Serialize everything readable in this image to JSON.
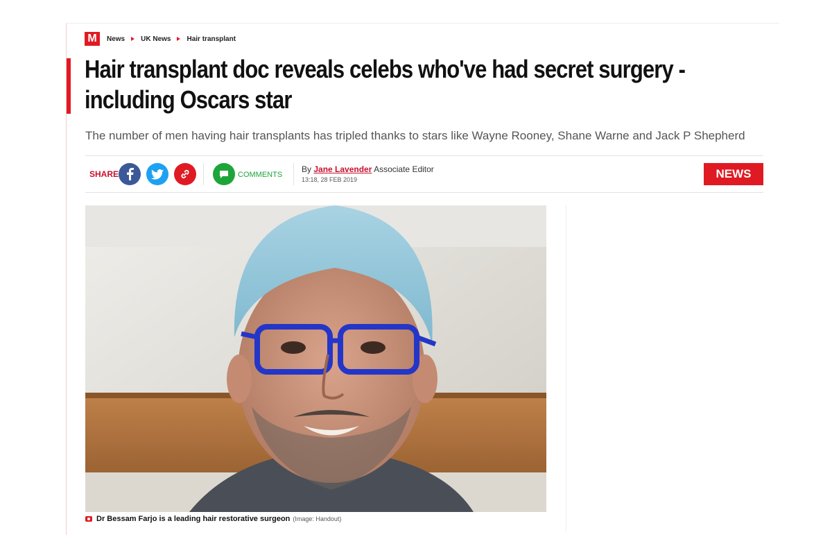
{
  "brand": {
    "logo_letter": "M",
    "accent_color": "#e01a22"
  },
  "breadcrumb": [
    "News",
    "UK News",
    "Hair transplant"
  ],
  "headline": "Hair transplant doc reveals celebs who've had secret surgery - including Oscars star",
  "subheadline": "The number of men having hair transplants has tripled thanks to stars like Wayne Rooney, Shane Warne and Jack P Shepherd",
  "share": {
    "label": "SHARE",
    "comments_label": "COMMENTS",
    "icons": [
      "facebook-icon",
      "twitter-icon",
      "link-icon",
      "comment-icon"
    ]
  },
  "byline": {
    "prefix": "By",
    "author": "Jane Lavender",
    "role": "Associate Editor",
    "timestamp": "13:18, 28 FEB 2019"
  },
  "section_badge": "NEWS",
  "photo": {
    "caption": "Dr Bessam Farjo is a leading hair restorative surgeon",
    "credit": "(Image: Handout)"
  }
}
